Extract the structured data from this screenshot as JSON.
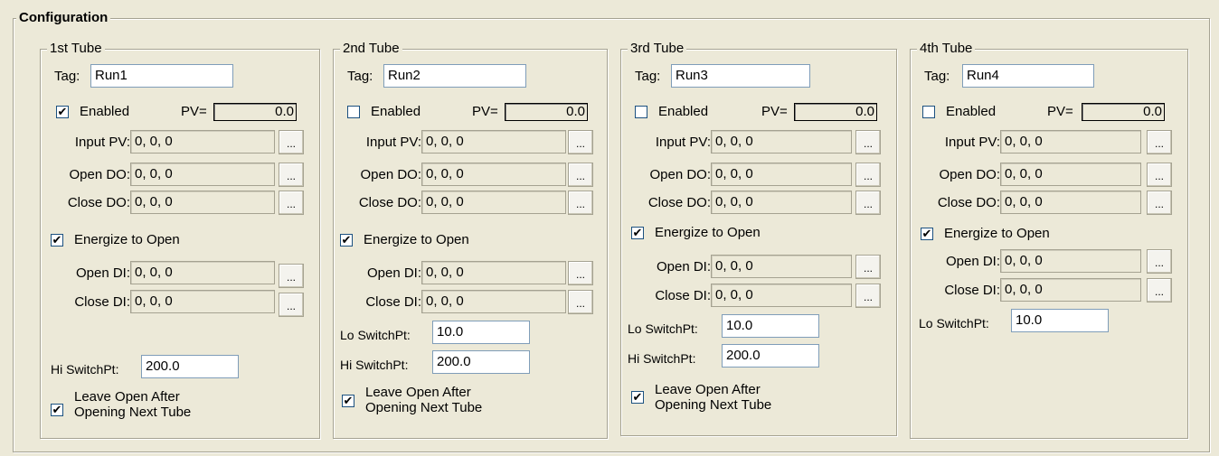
{
  "configuration_label": "Configuration",
  "button_label": "...",
  "labels": {
    "tag": "Tag:",
    "enabled": "Enabled",
    "pv": "PV=",
    "input_pv": "Input PV:",
    "open_do": "Open DO:",
    "close_do": "Close DO:",
    "energize": "Energize to Open",
    "open_di": "Open DI:",
    "close_di": "Close DI:",
    "lo_switch": "Lo SwitchPt:",
    "hi_switch": "Hi SwitchPt:",
    "leave_open": "Leave Open After Opening Next Tube"
  },
  "tubes": [
    {
      "title": "1st Tube",
      "tag": "Run1",
      "enabled": true,
      "pv": "0.0",
      "input_pv": "0, 0, 0",
      "open_do": "0, 0, 0",
      "close_do": "0, 0, 0",
      "energize_to_open": true,
      "open_di": "0, 0, 0",
      "close_di": "0, 0, 0",
      "hi_switch": "200.0",
      "leave_open": true
    },
    {
      "title": "2nd Tube",
      "tag": "Run2",
      "enabled": false,
      "pv": "0.0",
      "input_pv": "0, 0, 0",
      "open_do": "0, 0, 0",
      "close_do": "0, 0, 0",
      "energize_to_open": true,
      "open_di": "0, 0, 0",
      "close_di": "0, 0, 0",
      "lo_switch": "10.0",
      "hi_switch": "200.0",
      "leave_open": true
    },
    {
      "title": "3rd Tube",
      "tag": "Run3",
      "enabled": false,
      "pv": "0.0",
      "input_pv": "0, 0, 0",
      "open_do": "0, 0, 0",
      "close_do": "0, 0, 0",
      "energize_to_open": true,
      "open_di": "0, 0, 0",
      "close_di": "0, 0, 0",
      "lo_switch": "10.0",
      "hi_switch": "200.0",
      "leave_open": true
    },
    {
      "title": "4th Tube",
      "tag": "Run4",
      "enabled": false,
      "pv": "0.0",
      "input_pv": "0, 0, 0",
      "open_do": "0, 0, 0",
      "close_do": "0, 0, 0",
      "energize_to_open": true,
      "open_di": "0, 0, 0",
      "close_di": "0, 0, 0",
      "lo_switch": "10.0"
    }
  ]
}
